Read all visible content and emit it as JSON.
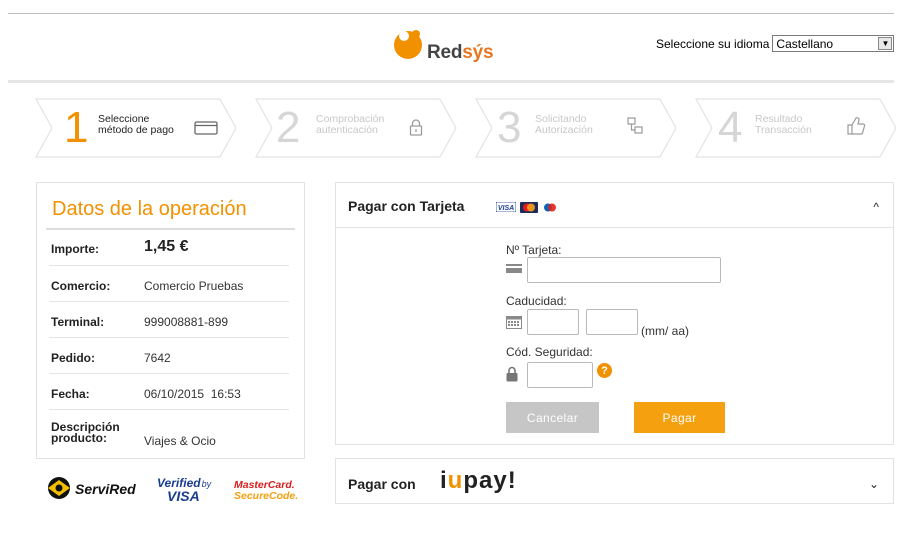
{
  "brand": {
    "name_part1": "Red",
    "name_part2": "sýs"
  },
  "language": {
    "label": "Seleccione su idioma",
    "selected": "Castellano"
  },
  "steps": [
    {
      "number": "1",
      "label": "Seleccione\nmétodo de pago",
      "icon": "credit-card-icon",
      "active": true
    },
    {
      "number": "2",
      "label": "Comprobación\nautenticación",
      "icon": "padlock-icon",
      "active": false
    },
    {
      "number": "3",
      "label": "Solicitando\nAutorización",
      "icon": "network-icon",
      "active": false
    },
    {
      "number": "4",
      "label": "Resultado\nTransacción",
      "icon": "thumbs-up-icon",
      "active": false
    }
  ],
  "operation": {
    "title": "Datos de la operación",
    "rows": [
      {
        "key": "Importe:",
        "value": "1,45 €"
      },
      {
        "key": "Comercio:",
        "value": "Comercio Pruebas"
      },
      {
        "key": "Terminal:",
        "value": "999008881-899"
      },
      {
        "key": "Pedido:",
        "value": "7642"
      },
      {
        "key": "Fecha:",
        "value": "06/10/2015  16:53"
      },
      {
        "key": "Descripción\nproducto:",
        "value": "Viajes & Ocio"
      }
    ]
  },
  "security_logos": {
    "servired": "ServiRed",
    "verified_top": "Verified",
    "verified_by": "by",
    "verified_visa": "VISA",
    "mastercard_top": "MasterCard.",
    "mastercard_bottom": "SecureCode."
  },
  "card_payment": {
    "title": "Pagar con Tarjeta",
    "card_label": "Nº Tarjeta:",
    "card_value": "",
    "expiry_label": "Caducidad:",
    "expiry_month": "",
    "expiry_year": "",
    "expiry_hint": "(mm/ aa)",
    "cvv_label": "Cód. Seguridad:",
    "cvv_value": "",
    "help_symbol": "?",
    "cancel_label": "Cancelar",
    "pay_label": "Pagar",
    "card_brands": {
      "visa": "VISA"
    }
  },
  "iupay": {
    "title": "Pagar con",
    "brand_a": "i",
    "brand_dot": "u",
    "brand_b": "pay!"
  },
  "colors": {
    "accent": "#f29100",
    "pay_button": "#f5a00f",
    "cancel_button": "#c6c6c6"
  }
}
